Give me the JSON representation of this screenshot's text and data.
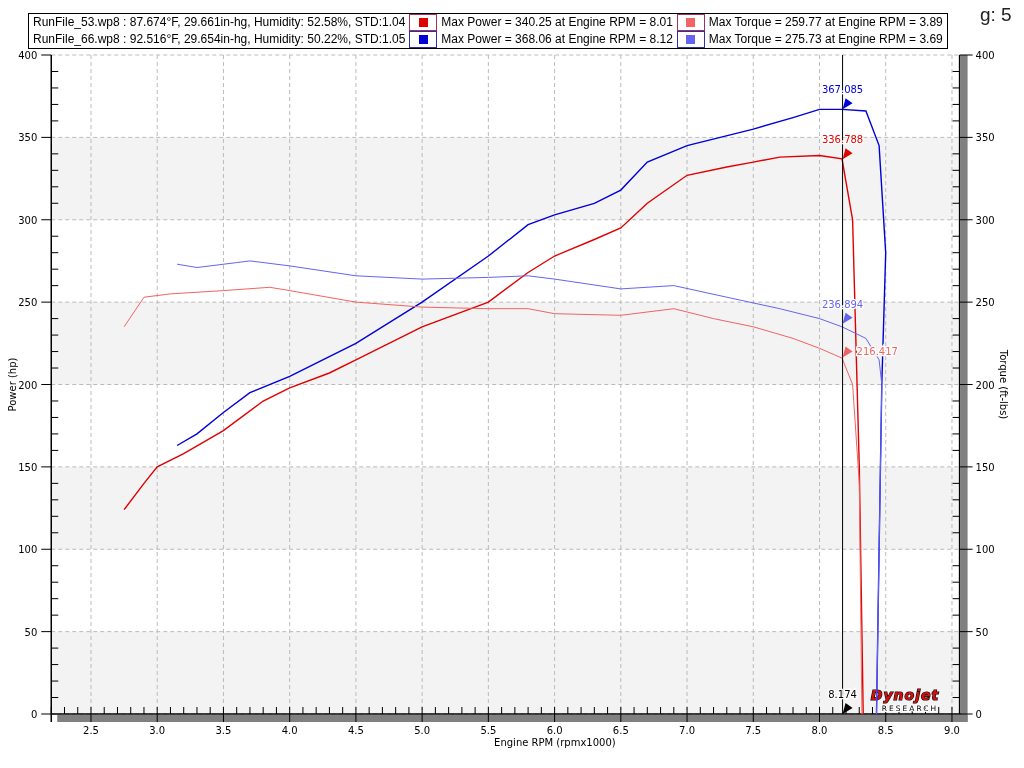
{
  "header": {
    "title_fragment": "g: 5"
  },
  "legend": [
    {
      "run": "RunFile_53.wp8 : 87.674°F, 29.661in-hg, Humidity: 52.58%, STD:1.04",
      "entries": [
        {
          "color": "#e00000",
          "text": "Max Power = 340.25 at Engine RPM = 8.01"
        },
        {
          "color": "#f06464",
          "text": "Max Torque = 259.77 at Engine RPM = 3.89"
        }
      ]
    },
    {
      "run": "RunFile_66.wp8 : 92.516°F, 29.654in-hg, Humidity: 50.22%, STD:1.05",
      "entries": [
        {
          "color": "#0000d8",
          "text": "Max Power = 368.06 at Engine RPM = 8.12"
        },
        {
          "color": "#6464f0",
          "text": "Max Torque = 275.73 at Engine RPM = 3.69"
        }
      ]
    }
  ],
  "chart": {
    "chart_data": {
      "type": "line",
      "xlabel": "Engine RPM (rpmx1000)",
      "ylabel": "Power (hp)",
      "xlim": [
        2.2,
        9.05
      ],
      "ylim": [
        0,
        400
      ],
      "grid": true,
      "xticks": [
        {
          "value": 2.5,
          "label": "2.5"
        },
        {
          "value": 3,
          "label": "3.0"
        },
        {
          "value": 3.5,
          "label": "3.5"
        },
        {
          "value": 4,
          "label": "4.0"
        },
        {
          "value": 4.5,
          "label": "4.5"
        },
        {
          "value": 5,
          "label": "5.0"
        },
        {
          "value": 5.5,
          "label": "5.5"
        },
        {
          "value": 6,
          "label": "6.0"
        },
        {
          "value": 6.5,
          "label": "6.5"
        },
        {
          "value": 7,
          "label": "7.0"
        },
        {
          "value": 7.5,
          "label": "7.5"
        },
        {
          "value": 8,
          "label": "8.0"
        },
        {
          "value": 8.5,
          "label": "8.5"
        },
        {
          "value": 9,
          "label": "9.0"
        }
      ],
      "yticks": [
        0,
        50,
        100,
        150,
        200,
        250,
        300,
        350,
        400
      ],
      "series": [
        {
          "color": "#e00000",
          "x": [
            2.75,
            2.9,
            3.0,
            3.2,
            3.5,
            3.8,
            4.0,
            4.3,
            4.5,
            5.0,
            5.5,
            5.8,
            6.0,
            6.3,
            6.5,
            6.7,
            7.0,
            7.3,
            7.5,
            7.7,
            8.0,
            8.17,
            8.25,
            8.3,
            8.33
          ],
          "values": [
            124,
            140,
            150,
            158,
            172,
            190,
            198,
            207,
            215,
            235,
            250,
            268,
            278,
            288,
            295,
            310,
            327,
            332,
            335,
            338,
            339,
            337,
            300,
            150,
            0
          ]
        },
        {
          "color": "#0000d8",
          "x": [
            3.15,
            3.3,
            3.5,
            3.7,
            4.0,
            4.5,
            5.0,
            5.5,
            5.8,
            6.0,
            6.3,
            6.5,
            6.7,
            7.0,
            7.5,
            7.8,
            8.0,
            8.17,
            8.35,
            8.45,
            8.5,
            8.47,
            8.45,
            8.43
          ],
          "values": [
            163,
            170,
            183,
            195,
            205,
            225,
            250,
            278,
            297,
            303,
            310,
            318,
            335,
            345,
            355,
            362,
            367,
            367,
            366,
            345,
            280,
            200,
            100,
            0
          ]
        },
        {
          "color": "#f06464",
          "x": [
            2.75,
            2.9,
            3.1,
            3.5,
            3.85,
            4.0,
            4.5,
            5.0,
            5.5,
            5.8,
            6.0,
            6.5,
            6.9,
            7.2,
            7.5,
            7.8,
            8.0,
            8.17,
            8.25,
            8.3,
            8.32
          ],
          "values": [
            235,
            253,
            255,
            257,
            259,
            257,
            250,
            247,
            246,
            246,
            243,
            242,
            246,
            240,
            235,
            228,
            222,
            216,
            200,
            140,
            0
          ]
        },
        {
          "color": "#6464f0",
          "x": [
            3.15,
            3.3,
            3.6,
            3.7,
            4.0,
            4.5,
            5.0,
            5.5,
            5.8,
            6.0,
            6.5,
            6.9,
            7.3,
            7.7,
            8.0,
            8.17,
            8.35,
            8.45,
            8.47,
            8.45,
            8.43
          ],
          "values": [
            273,
            271,
            274,
            275,
            272,
            266,
            264,
            265,
            266,
            264,
            258,
            260,
            253,
            246,
            240,
            235,
            228,
            215,
            200,
            100,
            0
          ]
        }
      ],
      "ref_lines": [
        {
          "axis": "x",
          "value": 8.174,
          "label": "8.174"
        }
      ],
      "annotations": [
        {
          "y": 367.085,
          "text": "367.085"
        },
        {
          "y": 336.788,
          "text": "336.788"
        },
        {
          "y": 236.894,
          "text": "236.894"
        },
        {
          "y": 216.417,
          "text": "216.417"
        }
      ]
    },
    "right_axis": {
      "title": "Torque (ft-lbs)",
      "ticks": [
        "400",
        "350",
        "300",
        "250",
        "200",
        "150",
        "100",
        "50",
        "0"
      ]
    }
  },
  "logo": {
    "name": "Dynojet",
    "tagline": "RESEARCH"
  }
}
